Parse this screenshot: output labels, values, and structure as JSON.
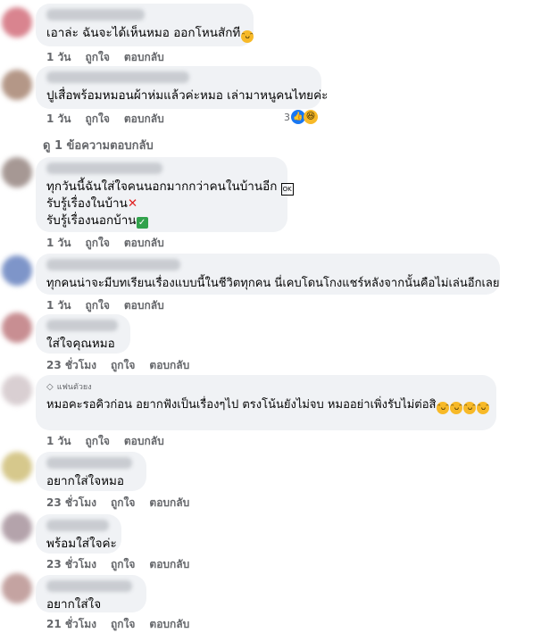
{
  "comments": [
    {
      "lines": [
        "เอาล่ะ ฉันจะได้เห็นหมอ ออกโหนสักที"
      ],
      "emoji": "grin-sweat-face",
      "time": "1 วัน",
      "like": "ถูกใจ",
      "reply": "ตอบกลับ",
      "avatar_color": "#d9848f"
    },
    {
      "lines": [
        "ปูเสื่อพร้อมหมอนผ้าห่มแล้วค่ะหมอ เล่ามาหนูคนไทยค่ะ"
      ],
      "time": "1 วัน",
      "like": "ถูกใจ",
      "reply": "ตอบกลับ",
      "reaction_count": "3",
      "reaction_icons": [
        "like-icon",
        "haha-icon"
      ],
      "avatar_color": "#b49787"
    },
    {
      "lines": [
        "ทุกวันนี้ฉันใส่ใจคนนอกมากกว่าคนในบ้านอีก",
        "รับรู้เรื่องในบ้าน",
        "รับรู้เรื่องนอกบ้าน"
      ],
      "time": "1 วัน",
      "like": "ถูกใจ",
      "reply": "ตอบกลับ",
      "avatar_color": "#a69894"
    },
    {
      "lines": [
        "ทุกคนน่าจะมีบทเรียนเรื่องแบบนี้ในชีวิตทุกคน นี่เคบโดนโกงแชร์หลังจากนั้นคือไม่เล่นอีกเลย"
      ],
      "time": "1 วัน",
      "like": "ถูกใจ",
      "reply": "ตอบกลับ",
      "avatar_color": "#7e95c9"
    },
    {
      "lines": [
        "ใส่ใจคุณหมอ"
      ],
      "time": "23 ชั่วโมง",
      "like": "ถูกใจ",
      "reply": "ตอบกลับ",
      "avatar_color": "#c88e92"
    },
    {
      "badge": "แฟนตัวยง",
      "lines": [
        "หมอคะรอคิวก่อน อยากฟังเป็นเรื่องๆไป ตรงโน้นยังไม่จบ หมออย่าเพิ่งรับไม่ต่อสิ"
      ],
      "time": "1 วัน",
      "like": "ถูกใจ",
      "reply": "ตอบกลับ",
      "avatar_color": "#d9cfd2"
    },
    {
      "lines": [
        "อยากใส่ใจหมอ"
      ],
      "time": "23 ชั่วโมง",
      "like": "ถูกใจ",
      "reply": "ตอบกลับ",
      "avatar_color": "#d6c88c"
    },
    {
      "lines": [
        "พร้อมใส่ใจค่ะ"
      ],
      "time": "23 ชั่วโมง",
      "like": "ถูกใจ",
      "reply": "ตอบกลับ",
      "avatar_color": "#b4a3ab"
    },
    {
      "lines": [
        "อยากใส่ใจ"
      ],
      "time": "21 ชั่วโมง",
      "like": "ถูกใจ",
      "reply": "ตอบกลับ",
      "avatar_color": "#c4a3a1"
    }
  ],
  "view_replies": "ดู 1 ข้อความตอบกลับ",
  "inline_emoji": {
    "x_mark": "❌",
    "check_mark": "✓",
    "box_glyph": "OK",
    "face_glyph": "ᵔᴗᵔ",
    "laugh_glyph": "ᵔᴗᵔ",
    "like_glyph": "👍",
    "haha_glyph": "ᵔᴗᵔ"
  }
}
